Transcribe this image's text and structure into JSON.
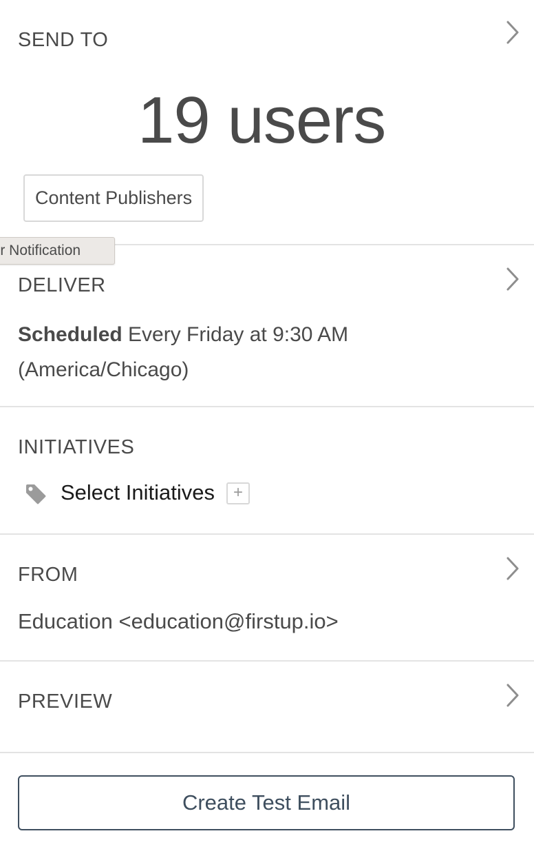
{
  "send_to": {
    "title": "SEND TO",
    "user_count": "19 users",
    "audience_chip": "Content Publishers"
  },
  "tooltip": {
    "text": "our Notification"
  },
  "deliver": {
    "title": "DELIVER",
    "status": "Scheduled",
    "schedule": " Every Friday at 9:30 AM (America/Chicago)"
  },
  "initiatives": {
    "title": "INITIATIVES",
    "icon": "tag-icon",
    "label": "Select Initiatives",
    "add_label": "+"
  },
  "from": {
    "title": "FROM",
    "sender": "Education <education@firstup.io>"
  },
  "preview": {
    "title": "PREVIEW"
  },
  "actions": {
    "create_test_email": "Create Test Email"
  },
  "colors": {
    "text": "#4a4a4a",
    "divider": "#e3e3e3",
    "button_border": "#3e4e5e",
    "tooltip_bg": "#ece9e6"
  }
}
